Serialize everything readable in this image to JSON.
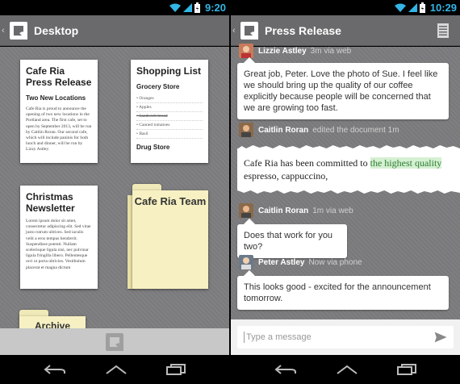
{
  "left_screen": {
    "status": {
      "time": "9:20"
    },
    "header": {
      "title": "Desktop"
    },
    "documents": [
      {
        "title": "Cafe Ria Press Release",
        "subtitle": "Two New Locations",
        "body": "Cafe Ria is proud to announce the opening of two new locations in the Portland area. The first cafe, set to open by September 2013, will be run by Caitlin Roran. Our second cafe, which will include paninis for both lunch and dinner, will be run by Lizzy Astley."
      },
      {
        "title": "Shopping List",
        "subtitle": "Grocery Store",
        "items": [
          "Oranges",
          "Apples",
          "Sandwich bread",
          "Canned tomatoes",
          "Basil"
        ],
        "footer": "Drug Store"
      },
      {
        "title": "Christmas Newsletter",
        "body": "Lorem ipsum dolor sit amet, consectetur adipiscing elit. Sed vitae justo rutrum ultrices. Sed iaculis velit a eros tempus hendrerit. Suspendisse potenti. Nullam scelerisque ligula nisi, nec pulvinar ligula fringilla libero. Pellentesque orci ut porta ultricies. Vestibulum placerat et magna dictum"
      }
    ],
    "folders": [
      {
        "label": "Cafe Ria Team"
      },
      {
        "label": "Archive"
      }
    ]
  },
  "right_screen": {
    "status": {
      "time": "10:29"
    },
    "header": {
      "title": "Press Release"
    },
    "messages": [
      {
        "name": "Lizzie Astley",
        "meta": "3m via web",
        "text": "Great job, Peter. Love the photo of Sue. I feel like we should bring up the quality of our coffee explicitly because people will be concerned that we are growing too fast."
      },
      {
        "name": "Caitlin Roran",
        "meta": "edited the document 1m",
        "excerpt_before": "Cafe Ria has been committed to ",
        "excerpt_highlight": "the highest quality",
        "excerpt_after": " espresso, cappuccino,"
      },
      {
        "name": "Caitlin Roran",
        "meta": "1m via web",
        "text": "Does that work for you two?"
      },
      {
        "name": "Peter Astley",
        "meta": "Now via phone",
        "text": "This looks good - excited for the announcement tomorrow."
      }
    ],
    "composer": {
      "placeholder": "Type a message"
    }
  },
  "colors": {
    "status_accent": "#33b5e5",
    "action_bar": "#6a6a6c",
    "highlight": "#d5f0d2",
    "folder": "#f7f0c2"
  }
}
